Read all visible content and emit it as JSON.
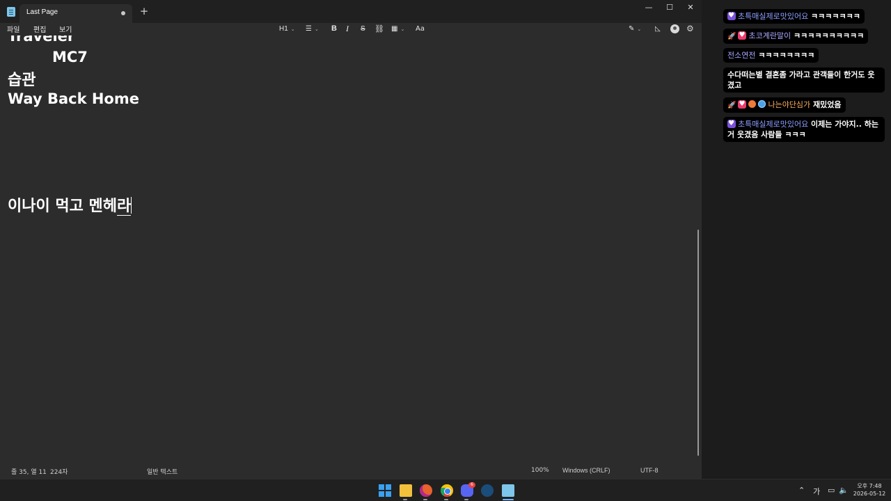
{
  "window": {
    "tab_title": "Last Page",
    "new_tab": "+",
    "controls": {
      "minimize": "—",
      "maximize": "☐",
      "close": "✕"
    }
  },
  "menu": {
    "file": "파일",
    "edit": "편집",
    "view": "보기"
  },
  "toolbar": {
    "heading": "H1",
    "chevron": "⌄",
    "list": "☰",
    "bold": "B",
    "italic": "I",
    "strike": "S",
    "link": "⛓",
    "table": "▦",
    "spell": "Aa",
    "pen": "✎",
    "share": "◺",
    "settings": "⚙"
  },
  "document": {
    "lines": [
      "Traveler",
      "MC7",
      "습관",
      "Way Back Home",
      "이나이 먹고 멘헤"
    ],
    "composing_char": "라"
  },
  "status": {
    "position": "줄 35, 열 11",
    "char_count": "224자",
    "format": "일반 텍스트",
    "zoom": "100%",
    "line_ending": "Windows (CRLF)",
    "encoding": "UTF-8"
  },
  "chat": {
    "messages": [
      {
        "nick": "초특매실제로맛있어요",
        "text": " ㅋㅋㅋㅋㅋㅋㅋ",
        "badges": [
          "purple-heart-badge"
        ]
      },
      {
        "nick": "초코계란말이",
        "text": " ㅋㅋㅋㅋㅋㅋㅋㅋㅋㅋ",
        "badges": [
          "rocket-badge",
          "pink-heart-badge"
        ]
      },
      {
        "nick": "전소연전",
        "text": " ㅋㅋㅋㅋㅋㅋㅋㅋ",
        "badges": []
      },
      {
        "nick": "수다떠는별",
        "text": " 결혼좀 가라고 관객들이 한거도 웃겼고",
        "badges": []
      },
      {
        "nick": "나는야단심가",
        "text": " 재밌었음",
        "badges": [
          "rocket-badge",
          "pink-heart-badge",
          "food-badge",
          "planet-badge"
        ]
      },
      {
        "nick": "초특매실제로맛있어요",
        "text": " 이제는 가야지.. 하는거 웃겼음 사람들 ㅋㅋㅋ",
        "badges": [
          "purple-heart-badge"
        ]
      }
    ]
  },
  "taskbar": {
    "discord_badge": "6",
    "ime": "가",
    "up_arrow": "⌃",
    "network": "▭",
    "volume": "🔈",
    "time": "오후 7:48",
    "date": "2026-05-12"
  },
  "colors": {
    "editor_bg": "#2c2c2c",
    "titlebar_bg": "#202020",
    "chat_bg": "#000000",
    "nick_blue": "#8c9eff",
    "nick_orange": "#ffb060"
  }
}
